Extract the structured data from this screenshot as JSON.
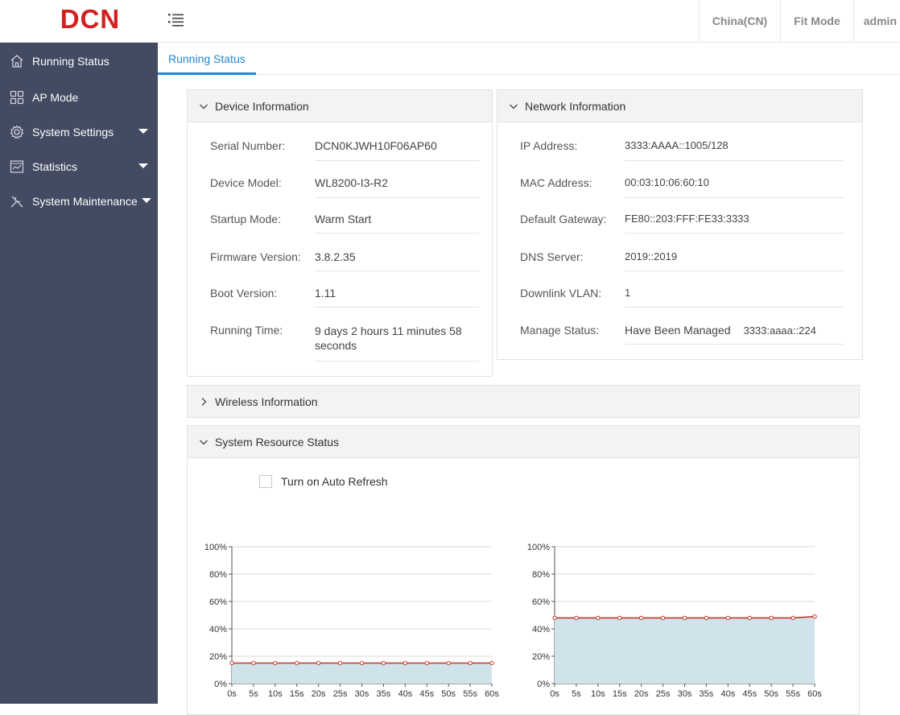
{
  "header": {
    "logo_text": "DCN",
    "language": "China(CN)",
    "mode": "Fit Mode",
    "user": "admin"
  },
  "sidebar": {
    "items": [
      {
        "label": "Running Status",
        "icon": "home-icon"
      },
      {
        "label": "AP Mode",
        "icon": "grid-icon"
      },
      {
        "label": "System Settings",
        "icon": "gear-icon"
      },
      {
        "label": "Statistics",
        "icon": "chart-icon"
      },
      {
        "label": "System Maintenance",
        "icon": "tools-icon"
      }
    ]
  },
  "tabs": [
    {
      "label": "Running Status"
    }
  ],
  "device": {
    "title": "Device Information",
    "rows": [
      {
        "label": "Serial Number:",
        "value": "DCN0KJWH10F06AP60"
      },
      {
        "label": "Device Model:",
        "value": "WL8200-I3-R2"
      },
      {
        "label": "Startup Mode:",
        "value": "Warm Start"
      },
      {
        "label": "Firmware Version:",
        "value": "3.8.2.35"
      },
      {
        "label": "Boot Version:",
        "value": "1.11"
      },
      {
        "label": "Running Time:",
        "value": "9 days 2 hours 11 minutes 58 seconds"
      }
    ]
  },
  "network": {
    "title": "Network Information",
    "rows": [
      {
        "label": "IP Address:",
        "value": "3333:AAAA::1005/128"
      },
      {
        "label": "MAC Address:",
        "value": "00:03:10:06:60:10"
      },
      {
        "label": "Default Gateway:",
        "value": "FE80::203:FFF:FE33:3333"
      },
      {
        "label": "DNS Server:",
        "value": "2019::2019"
      },
      {
        "label": "Downlink VLAN:",
        "value": "1"
      },
      {
        "label": "Manage Status:",
        "value": "Have Been Managed",
        "extra": "3333:aaaa::224"
      }
    ]
  },
  "wireless": {
    "title": "Wireless Information"
  },
  "resource": {
    "title": "System Resource Status",
    "auto_refresh_label": "Turn on Auto Refresh"
  },
  "colors": {
    "accent": "#1e88d2",
    "sidebar": "#434b63",
    "series_line": "#c0392b",
    "series_fill": "#cfe3ea"
  },
  "chart_data": [
    {
      "type": "area",
      "x": [
        "0s",
        "5s",
        "10s",
        "15s",
        "20s",
        "25s",
        "30s",
        "35s",
        "40s",
        "45s",
        "50s",
        "55s",
        "60s"
      ],
      "y_ticks": [
        "0%",
        "20%",
        "40%",
        "60%",
        "80%",
        "100%"
      ],
      "ylim": [
        0,
        100
      ],
      "series": [
        {
          "values": [
            15,
            15,
            15,
            15,
            15,
            15,
            15,
            15,
            15,
            15,
            15,
            15,
            15
          ]
        }
      ]
    },
    {
      "type": "area",
      "x": [
        "0s",
        "5s",
        "10s",
        "15s",
        "20s",
        "25s",
        "30s",
        "35s",
        "40s",
        "45s",
        "50s",
        "55s",
        "60s"
      ],
      "y_ticks": [
        "0%",
        "20%",
        "40%",
        "60%",
        "80%",
        "100%"
      ],
      "ylim": [
        0,
        100
      ],
      "series": [
        {
          "values": [
            48,
            48,
            48,
            48,
            48,
            48,
            48,
            48,
            48,
            48,
            48,
            48,
            49
          ]
        }
      ]
    }
  ]
}
